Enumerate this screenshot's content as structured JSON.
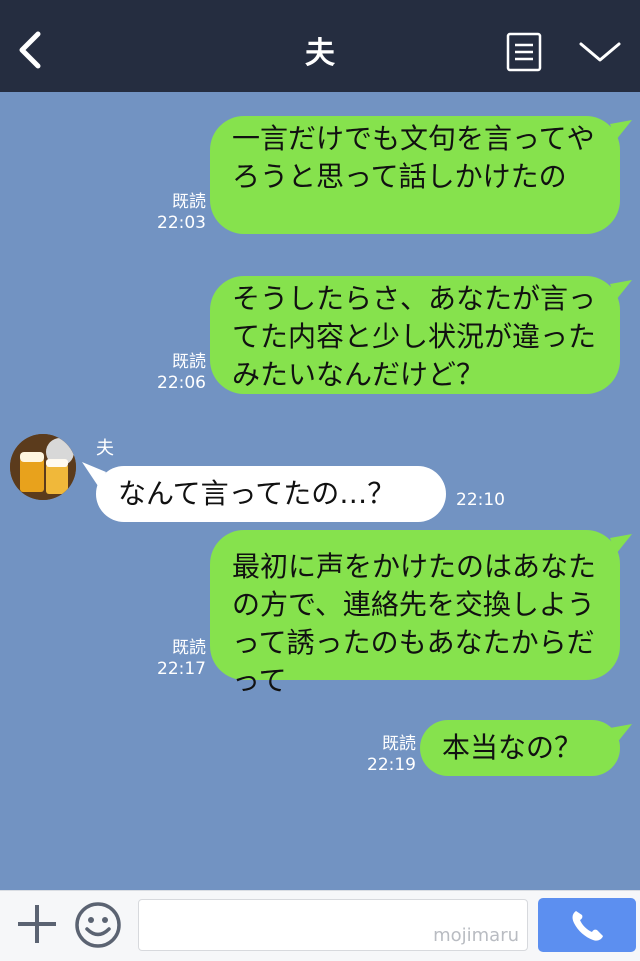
{
  "header": {
    "title": "夫"
  },
  "messages": [
    {
      "type": "out",
      "text": "一言だけでも文句を言ってやろうと思って話しかけたの",
      "read": "既読",
      "time": "22:03"
    },
    {
      "type": "out",
      "text": "そうしたらさ、あなたが言ってた内容と少し状況が違ったみたいなんだけど？",
      "read": "既読",
      "time": "22:06"
    },
    {
      "type": "in",
      "sender": "夫",
      "text": "なんて言ってたの…？",
      "time": "22:10"
    },
    {
      "type": "out",
      "text": "最初に声をかけたのはあなたの方で、連絡先を交換しようって誘ったのもあなたからだって",
      "read": "既読",
      "time": "22:17"
    },
    {
      "type": "out",
      "text": "本当なの？",
      "read": "既読",
      "time": "22:19"
    }
  ],
  "input": {
    "watermark": "mojimaru"
  },
  "icons": {
    "back": "back-chevron-icon",
    "menu": "menu-icon",
    "collapse": "chevron-down-icon",
    "plus": "plus-icon",
    "emoji": "smile-icon",
    "call": "phone-icon"
  },
  "colors": {
    "header_bg": "#252d40",
    "chat_bg": "#7293c2",
    "bubble_out": "#86e24d",
    "bubble_in": "#ffffff",
    "call_button": "#5c8ff0"
  }
}
